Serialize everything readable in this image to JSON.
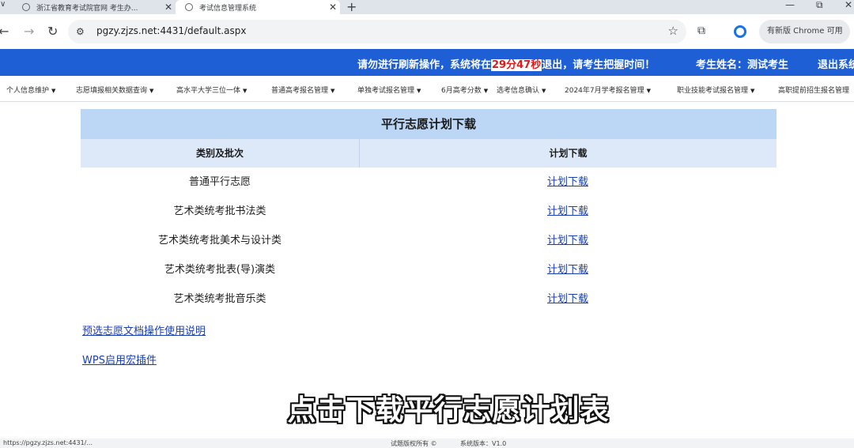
{
  "browser": {
    "tabs": [
      {
        "title": "浙江省教育考试院官网 考生办..."
      },
      {
        "title": "考试信息管理系统"
      }
    ],
    "new_tab": "+",
    "window_controls": {
      "minimize": "—",
      "maximize": "⧉",
      "close": "✕"
    },
    "url": "pgzy.zjzs.net:4431/default.aspx",
    "update_label": "有新版 Chrome 可用"
  },
  "header": {
    "countdown_prefix": "请勿进行刷新操作，系统将在",
    "countdown_timer": "29分47秒",
    "countdown_suffix": "退出，请考生把握时间！",
    "examinee": "考生姓名：测试考生",
    "logout": "退出系统"
  },
  "menu": [
    "个人信息维护",
    "志愿填报相关数据查询",
    "高水平大学三位一体",
    "普通高考报名管理",
    "单独考试报名管理",
    "6月高考分数",
    "选考信息确认",
    "2024年7月学考报名管理",
    "职业技能考试报名管理",
    "高职提前招生报名管理"
  ],
  "plan_table": {
    "title": "平行志愿计划下载",
    "col_category": "类别及批次",
    "col_download": "计划下载",
    "rows": [
      {
        "category": "普通平行志愿",
        "link": "计划下载"
      },
      {
        "category": "艺术类统考批书法类",
        "link": "计划下载"
      },
      {
        "category": "艺术类统考批美术与设计类",
        "link": "计划下载"
      },
      {
        "category": "艺术类统考批表(导)演类",
        "link": "计划下载"
      },
      {
        "category": "艺术类统考批音乐类",
        "link": "计划下载"
      }
    ]
  },
  "links": {
    "manual": "预选志愿文档操作使用说明",
    "wps_plugin": "WPS启用宏插件"
  },
  "subtitle": "点击下载平行志愿计划表",
  "statusbar": {
    "url_preview": "https://pgzy.zjzs.net:4431/...",
    "copyright": "试题版权所有 ©",
    "version": "系统版本：V1.0"
  }
}
